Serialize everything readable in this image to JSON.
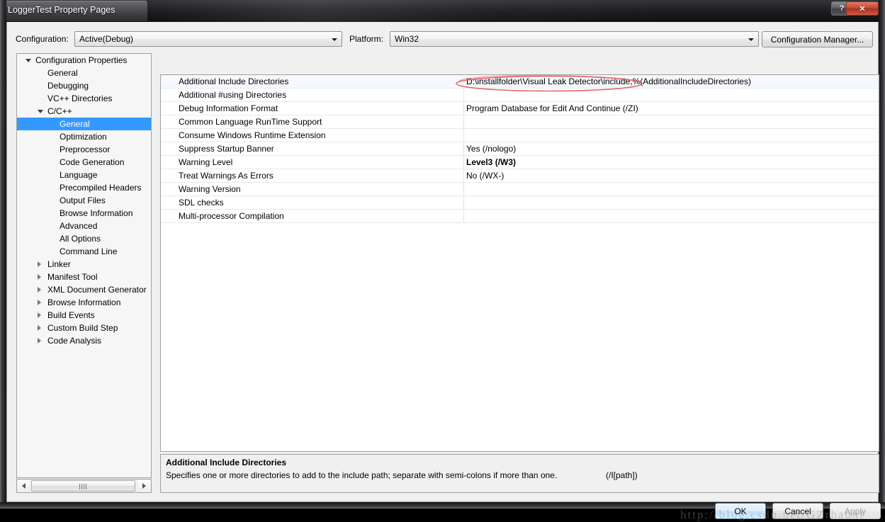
{
  "window": {
    "title": "LoggerTest Property Pages",
    "help_button": "?",
    "close_button": "✕"
  },
  "toolbar": {
    "configuration_label": "Configuration:",
    "configuration_value": "Active(Debug)",
    "platform_label": "Platform:",
    "platform_value": "Win32",
    "configuration_manager_label": "Configuration Manager..."
  },
  "tree": {
    "items": [
      {
        "label": "Configuration Properties",
        "indent": 0,
        "twisty": "expanded",
        "selected": false
      },
      {
        "label": "General",
        "indent": 1,
        "twisty": "none",
        "selected": false
      },
      {
        "label": "Debugging",
        "indent": 1,
        "twisty": "none",
        "selected": false
      },
      {
        "label": "VC++ Directories",
        "indent": 1,
        "twisty": "none",
        "selected": false
      },
      {
        "label": "C/C++",
        "indent": 1,
        "twisty": "expanded",
        "selected": false
      },
      {
        "label": "General",
        "indent": 2,
        "twisty": "none",
        "selected": true
      },
      {
        "label": "Optimization",
        "indent": 2,
        "twisty": "none",
        "selected": false
      },
      {
        "label": "Preprocessor",
        "indent": 2,
        "twisty": "none",
        "selected": false
      },
      {
        "label": "Code Generation",
        "indent": 2,
        "twisty": "none",
        "selected": false
      },
      {
        "label": "Language",
        "indent": 2,
        "twisty": "none",
        "selected": false
      },
      {
        "label": "Precompiled Headers",
        "indent": 2,
        "twisty": "none",
        "selected": false
      },
      {
        "label": "Output Files",
        "indent": 2,
        "twisty": "none",
        "selected": false
      },
      {
        "label": "Browse Information",
        "indent": 2,
        "twisty": "none",
        "selected": false
      },
      {
        "label": "Advanced",
        "indent": 2,
        "twisty": "none",
        "selected": false
      },
      {
        "label": "All Options",
        "indent": 2,
        "twisty": "none",
        "selected": false
      },
      {
        "label": "Command Line",
        "indent": 2,
        "twisty": "none",
        "selected": false
      },
      {
        "label": "Linker",
        "indent": 1,
        "twisty": "collapsed",
        "selected": false
      },
      {
        "label": "Manifest Tool",
        "indent": 1,
        "twisty": "collapsed",
        "selected": false
      },
      {
        "label": "XML Document Generator",
        "indent": 1,
        "twisty": "collapsed",
        "selected": false
      },
      {
        "label": "Browse Information",
        "indent": 1,
        "twisty": "collapsed",
        "selected": false
      },
      {
        "label": "Build Events",
        "indent": 1,
        "twisty": "collapsed",
        "selected": false
      },
      {
        "label": "Custom Build Step",
        "indent": 1,
        "twisty": "collapsed",
        "selected": false
      },
      {
        "label": "Code Analysis",
        "indent": 1,
        "twisty": "collapsed",
        "selected": false
      }
    ],
    "scrollbar": {
      "left_arrow": "◀",
      "right_arrow": "▶"
    }
  },
  "grid": {
    "rows": [
      {
        "name": "Additional Include Directories",
        "value": "D:\\installfolder\\Visual Leak Detector\\include;%(AdditionalIncludeDirectories)",
        "bold": false,
        "selected": true
      },
      {
        "name": "Additional #using Directories",
        "value": "",
        "bold": false,
        "selected": false
      },
      {
        "name": "Debug Information Format",
        "value": "Program Database for Edit And Continue (/ZI)",
        "bold": false,
        "selected": false
      },
      {
        "name": "Common Language RunTime Support",
        "value": "",
        "bold": false,
        "selected": false
      },
      {
        "name": "Consume Windows Runtime Extension",
        "value": "",
        "bold": false,
        "selected": false
      },
      {
        "name": "Suppress Startup Banner",
        "value": "Yes (/nologo)",
        "bold": false,
        "selected": false
      },
      {
        "name": "Warning Level",
        "value": "Level3 (/W3)",
        "bold": true,
        "selected": false
      },
      {
        "name": "Treat Warnings As Errors",
        "value": "No (/WX-)",
        "bold": false,
        "selected": false
      },
      {
        "name": "Warning Version",
        "value": "",
        "bold": false,
        "selected": false
      },
      {
        "name": "SDL checks",
        "value": "",
        "bold": false,
        "selected": false
      },
      {
        "name": "Multi-processor Compilation",
        "value": "",
        "bold": false,
        "selected": false
      }
    ]
  },
  "annotation": {
    "shape": "red-ellipse",
    "color": "#e05050",
    "targets": "Additional Include Directories value"
  },
  "description": {
    "title": "Additional Include Directories",
    "body": "Specifies one or more directories to add to the include path; separate with semi-colons if more than one.",
    "switch": "(/I[path])"
  },
  "buttons": {
    "ok": "OK",
    "cancel": "Cancel",
    "apply": "Apply"
  },
  "watermark": {
    "text": "http://blog.csdn.net/GZrhaunt"
  }
}
